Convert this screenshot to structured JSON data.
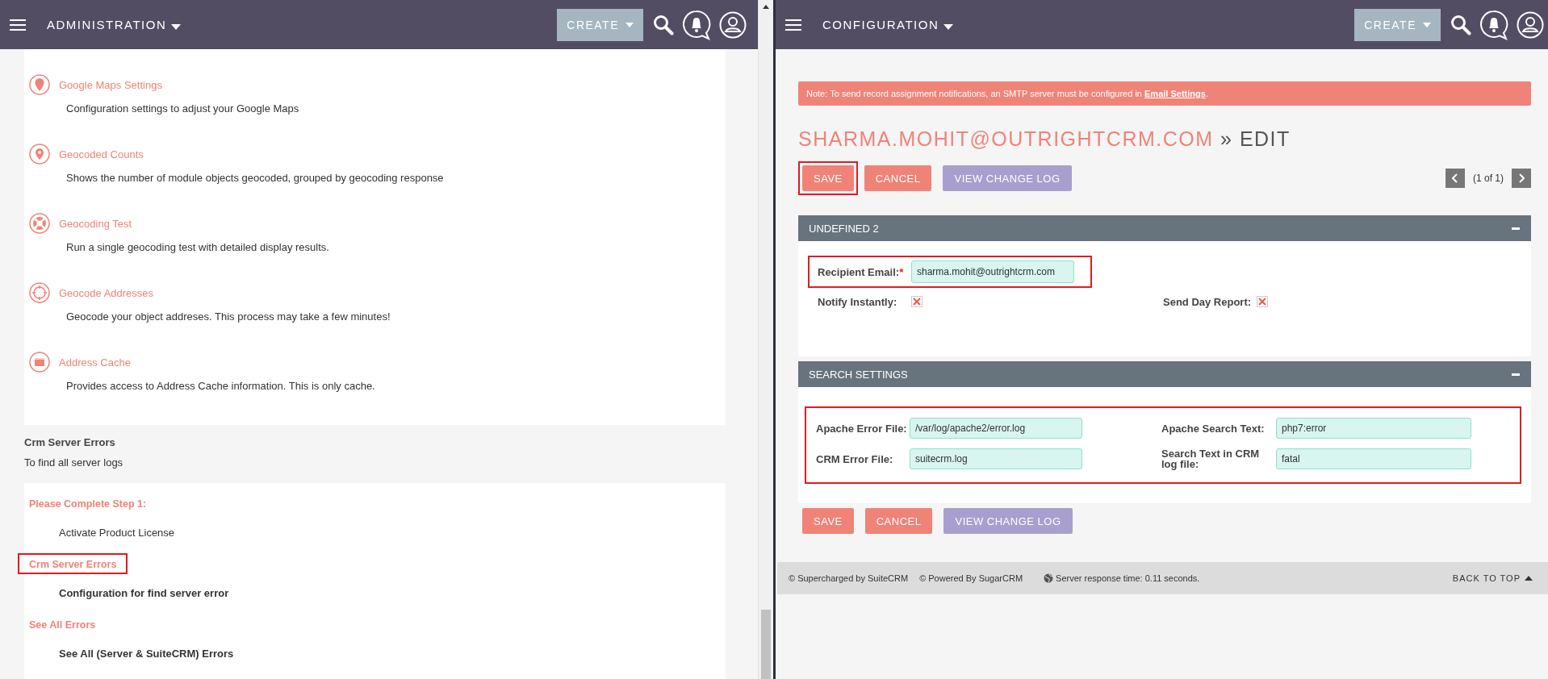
{
  "left_pane": {
    "header": {
      "module": "ADMINISTRATION",
      "create": "CREATE"
    },
    "admin_items": [
      {
        "title": "Google Maps Settings",
        "description": "Configuration settings to adjust your Google Maps"
      },
      {
        "title": "Geocoded Counts",
        "description": "Shows the number of module objects geocoded, grouped by geocoding response"
      },
      {
        "title": "Geocoding Test",
        "description": "Run a single geocoding test with detailed display results."
      },
      {
        "title": "Geocode Addresses",
        "description": "Geocode your object addreses. This process may take a few minutes!"
      },
      {
        "title": "Address Cache",
        "description": "Provides access to Address Cache information. This is only cache."
      }
    ],
    "section": {
      "title": "Crm Server Errors",
      "description": "To find all server logs"
    },
    "section_items": [
      {
        "title": "Please Complete Step 1:",
        "description": "Activate Product License",
        "bold": false,
        "highlighted": false
      },
      {
        "title": "Crm Server Errors",
        "description": "Configuration for find server error",
        "bold": true,
        "highlighted": true
      },
      {
        "title": "See All Errors",
        "description": "See All (Server & SuiteCRM) Errors",
        "bold": true,
        "highlighted": false
      }
    ]
  },
  "right_pane": {
    "header": {
      "module": "CONFIGURATION",
      "create": "CREATE"
    },
    "note": {
      "text": "Note: To send record assignment notifications, an SMTP server must be configured in ",
      "link": "Email Settings",
      "after": "."
    },
    "title": {
      "record": "SHARMA.MOHIT@OUTRIGHTCRM.COM",
      "separator": "»",
      "action": "EDIT"
    },
    "action_bars": [
      {
        "buttons": [
          {
            "label": "SAVE",
            "kind": "save",
            "highlighted": true
          },
          {
            "label": "CANCEL",
            "kind": "cancel",
            "highlighted": false
          },
          {
            "label": "VIEW CHANGE LOG",
            "kind": "log",
            "highlighted": false
          }
        ],
        "pagination": {
          "count": "(1 of 1)"
        }
      },
      {
        "buttons": [
          {
            "label": "SAVE",
            "kind": "save",
            "highlighted": false
          },
          {
            "label": "CANCEL",
            "kind": "cancel",
            "highlighted": false
          },
          {
            "label": "VIEW CHANGE LOG",
            "kind": "log",
            "highlighted": false
          }
        ]
      }
    ],
    "panels": [
      {
        "title": "UNDEFINED 2",
        "email": {
          "label": "Recipient Email:",
          "required_mark": "*",
          "value": "sharma.mohit@outrightcrm.com",
          "highlighted": true
        },
        "flags": [
          {
            "label": "Notify Instantly:"
          },
          {
            "label": "Send Day Report:"
          }
        ]
      },
      {
        "title": "SEARCH SETTINGS",
        "highlighted": true,
        "fields": [
          {
            "label": "Apache Error File:",
            "value": "/var/log/apache2/error.log"
          },
          {
            "label": "Apache Search Text:",
            "value": "php7:error"
          },
          {
            "label": "CRM Error File:",
            "value": "suitecrm.log"
          },
          {
            "label": "Search Text in CRM log file:",
            "value": "fatal"
          }
        ]
      }
    ],
    "footer": {
      "credits": [
        "© Supercharged by SuiteCRM",
        "© Powered By SugarCRM"
      ],
      "response": "Server response time: 0.11 seconds.",
      "back_to_top": "BACK TO TOP"
    }
  }
}
